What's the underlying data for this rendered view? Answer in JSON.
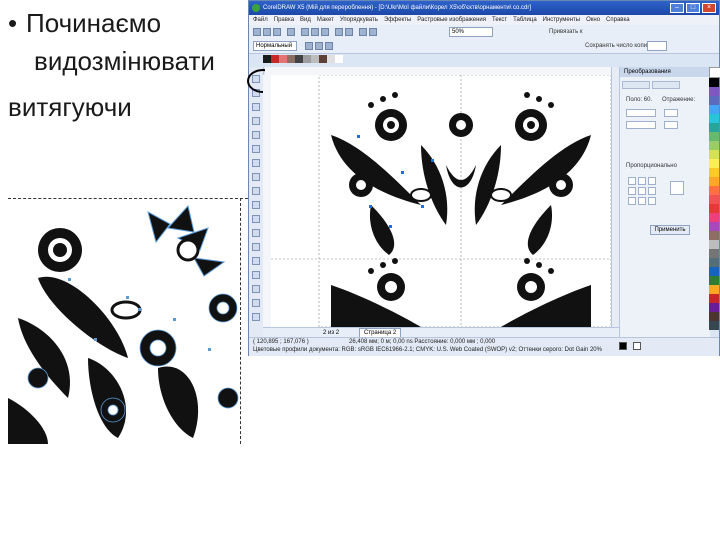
{
  "slide": {
    "bullet": "•",
    "line1": "Починаємо",
    "line2": "видозмінювати",
    "line3": "витягуючи"
  },
  "window": {
    "title": "CorelDRAW X5 (Мій для перероблення) - [D:\\Ukr\\Мої файли\\Корел X5\\об'єктв\\орнаменти\\ сo.cdr]",
    "controls": {
      "minimize": "–",
      "maximize": "□",
      "close": "×"
    },
    "menu": [
      "Файл",
      "Правка",
      "Вид",
      "Макет",
      "Упорядкувать",
      "Эффекты",
      "Растровые изображения",
      "Текст",
      "Таблица",
      "Инструменты",
      "Окно",
      "Справка"
    ],
    "toolbar": {
      "zoom_value": "50%",
      "snap_label": "Привязать к"
    },
    "propbar": {
      "style_value": "Нормальный",
      "save_label": "Сохранять число копий"
    },
    "docker": {
      "title": "Преобразования",
      "position_label": "Поло: 60.",
      "reflect_label": "Отражение:",
      "checkbox_label": "Пропорционально",
      "apply_button": "Применить"
    },
    "page": {
      "counter": "2 из 2",
      "tab": "Страница 2"
    },
    "status": {
      "coords": "( 120,895 ; 167,076 )",
      "info": "26,408 мм; 0 м; 0,00 ns Расстояние: 0,000 мм ; 0,000 ",
      "profile": "Цветовые профили документа: RGB: sRGB IEC61966-2.1; CMYK: U.S. Web Coated (SWOP) v2; Оттенки серого: Dot Gain 20%"
    }
  },
  "icons": [
    "app-icon",
    "minimize-icon",
    "maximize-icon",
    "close-icon",
    "pick-tool-icon",
    "shape-tool-icon",
    "zoom-tool-icon"
  ],
  "colors": {
    "title_bar": "#2e63c9",
    "highlight": "#000000",
    "selection_handle": "#1e6fd9"
  }
}
